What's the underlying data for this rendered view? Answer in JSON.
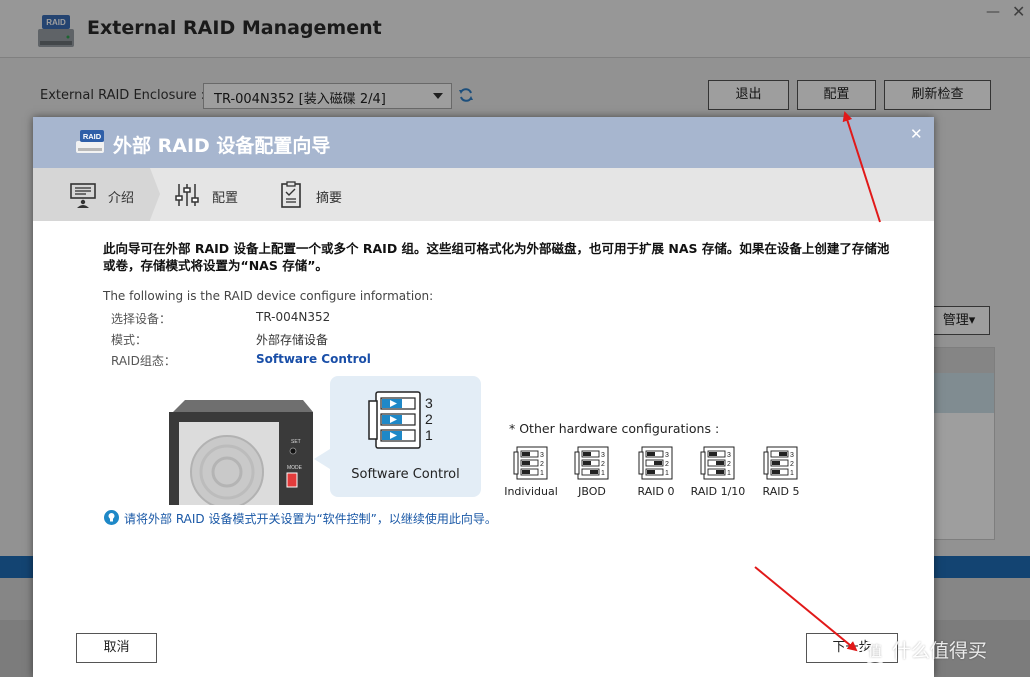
{
  "app": {
    "title": "External RAID Management",
    "icon_badge": "RAID",
    "enclosure_label": "External RAID Enclosure :",
    "enclosure_value": "TR-004N352 [装入磁碟 2/4]",
    "buttons": {
      "exit": "退出",
      "config": "配置",
      "refresh": "刷新检查"
    },
    "manage_button": "管理▾"
  },
  "wizard": {
    "title": "外部 RAID 设备配置向导",
    "badge": "RAID",
    "steps": [
      {
        "label": "介绍",
        "icon": "intro-icon"
      },
      {
        "label": "配置",
        "icon": "sliders-icon"
      },
      {
        "label": "摘要",
        "icon": "summary-icon"
      }
    ],
    "intro_text": "此向导可在外部 RAID 设备上配置一个或多个 RAID 组。这些组可格式化为外部磁盘，也可用于扩展 NAS 存储。如果在设备上创建了存储池或卷，存储模式将设置为“NAS 存储”。",
    "info_heading": "The following is the RAID device configure information:",
    "info_rows": [
      {
        "label": "选择设备：",
        "value": "TR-004N352"
      },
      {
        "label": "模式：",
        "value": "外部存储设备"
      },
      {
        "label": "RAID组态：",
        "value": "Software Control"
      }
    ],
    "device_labels": {
      "set": "SET",
      "mode": "MODE"
    },
    "callout_label": "Software Control",
    "switch_numbers": [
      "3",
      "2",
      "1"
    ],
    "other_heading": "* Other hardware configurations :",
    "other_configs": [
      {
        "label": "Individual",
        "on": [
          false,
          false,
          false
        ]
      },
      {
        "label": "JBOD",
        "on": [
          false,
          false,
          true
        ]
      },
      {
        "label": "RAID 0",
        "on": [
          false,
          true,
          false
        ]
      },
      {
        "label": "RAID 1/10",
        "on": [
          false,
          true,
          true
        ]
      },
      {
        "label": "RAID 5",
        "on": [
          true,
          false,
          false
        ]
      }
    ],
    "tip": "请将外部 RAID 设备模式开关设置为“软件控制”，以继续使用此向导。",
    "cancel_button": "取消",
    "next_button": "下一步"
  },
  "watermark": {
    "badge": "值",
    "text": "什么值得买"
  },
  "colors": {
    "header": "#a7b6cf",
    "link": "#1a4fa8",
    "tip": "#1a58a6",
    "arrow": "#e11919"
  }
}
